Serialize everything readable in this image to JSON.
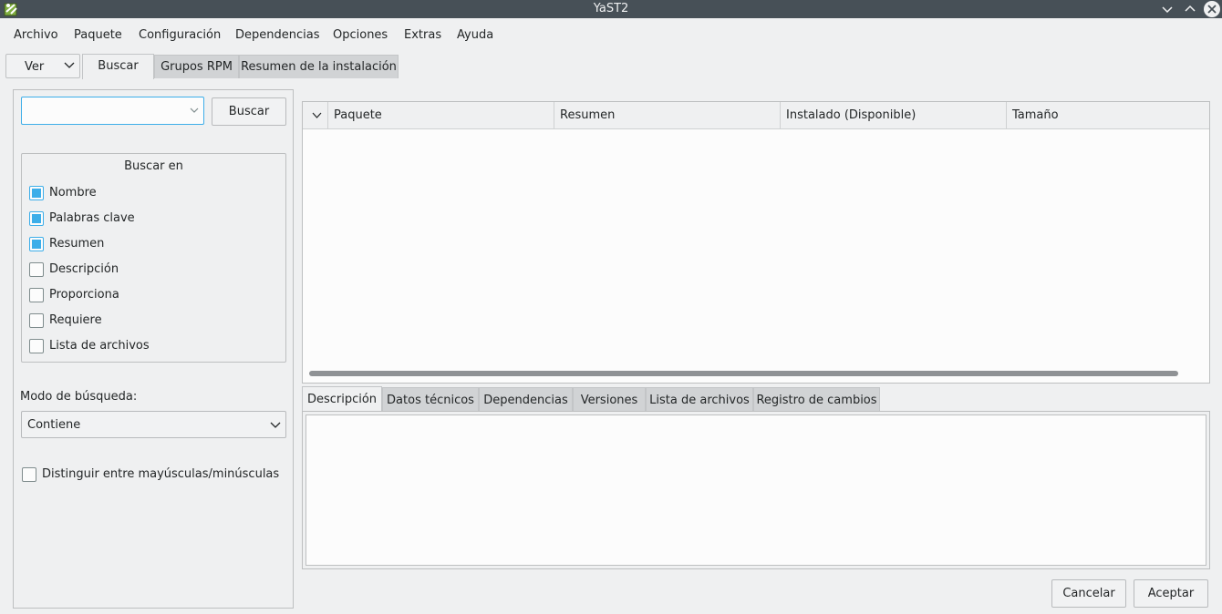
{
  "window": {
    "title": "YaST2"
  },
  "menu": [
    "Archivo",
    "Paquete",
    "Configuración",
    "Dependencias",
    "Opciones",
    "Extras",
    "Ayuda"
  ],
  "top_tabs": {
    "view_dropdown": "Ver",
    "tabs": [
      "Buscar",
      "Grupos RPM",
      "Resumen de la instalación"
    ],
    "active": "Buscar"
  },
  "search": {
    "input_value": "",
    "button_label": "Buscar",
    "group_title": "Buscar en",
    "fields": [
      {
        "label": "Nombre",
        "checked": true
      },
      {
        "label": "Palabras clave",
        "checked": true
      },
      {
        "label": "Resumen",
        "checked": true
      },
      {
        "label": "Descripción",
        "checked": false
      },
      {
        "label": "Proporciona",
        "checked": false
      },
      {
        "label": "Requiere",
        "checked": false
      },
      {
        "label": "Lista de archivos",
        "checked": false
      }
    ],
    "mode_label": "Modo de búsqueda:",
    "mode_value": "Contiene",
    "case_label": "Distinguir entre mayúsculas/minúsculas",
    "case_checked": false
  },
  "table": {
    "columns": [
      "Paquete",
      "Resumen",
      "Instalado (Disponible)",
      "Tamaño"
    ],
    "rows": []
  },
  "detail_tabs": {
    "tabs": [
      "Descripción",
      "Datos técnicos",
      "Dependencias",
      "Versiones",
      "Lista de archivos",
      "Registro de cambios"
    ],
    "active": "Descripción"
  },
  "buttons": {
    "cancel": "Cancelar",
    "accept": "Aceptar"
  },
  "colors": {
    "accent": "#3daee9",
    "titlebar": "#475057",
    "window_bg": "#eff0f1"
  }
}
